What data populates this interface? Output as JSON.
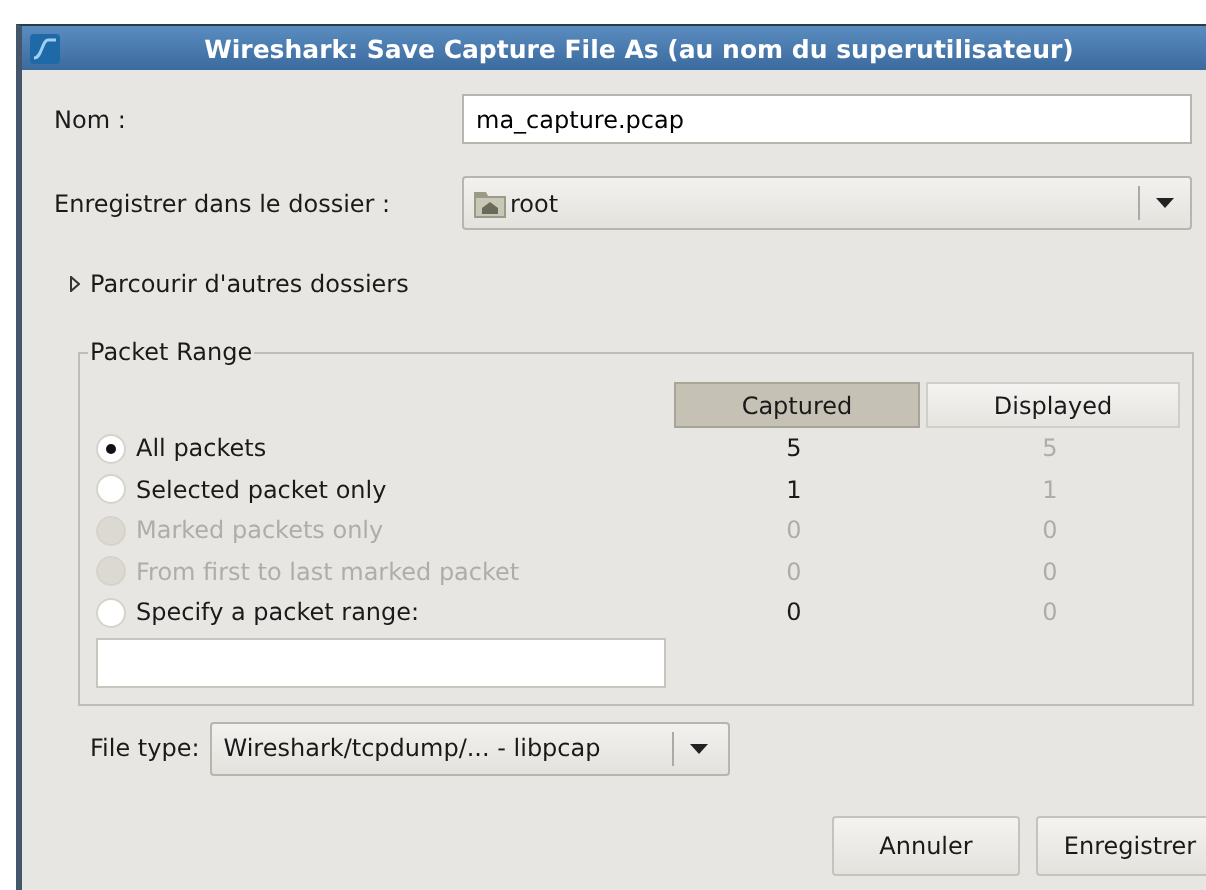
{
  "window": {
    "title": "Wireshark: Save Capture File As (au nom du superutilisateur)"
  },
  "name_field": {
    "label": "Nom :",
    "value": "ma_capture.pcap"
  },
  "folder": {
    "label": "Enregistrer dans le dossier :",
    "value": "root"
  },
  "browse": {
    "label": "Parcourir d'autres dossiers",
    "expanded": false
  },
  "packet_range": {
    "title": "Packet Range",
    "columns": [
      {
        "label": "Captured",
        "selected": true
      },
      {
        "label": "Displayed",
        "selected": false
      }
    ],
    "rows": [
      {
        "label": "All packets",
        "selected": true,
        "disabled": false,
        "captured": "5",
        "displayed": "5"
      },
      {
        "label": "Selected packet only",
        "selected": false,
        "disabled": false,
        "captured": "1",
        "displayed": "1"
      },
      {
        "label": "Marked packets only",
        "selected": false,
        "disabled": true,
        "captured": "0",
        "displayed": "0"
      },
      {
        "label": "From first to last marked packet",
        "selected": false,
        "disabled": true,
        "captured": "0",
        "displayed": "0"
      },
      {
        "label": "Specify a packet range:",
        "selected": false,
        "disabled": false,
        "captured": "0",
        "displayed": "0"
      }
    ]
  },
  "file_type": {
    "label": "File type:",
    "value": "Wireshark/tcpdump/... - libpcap"
  },
  "buttons": [
    "Annuler",
    "Enregistrer"
  ]
}
